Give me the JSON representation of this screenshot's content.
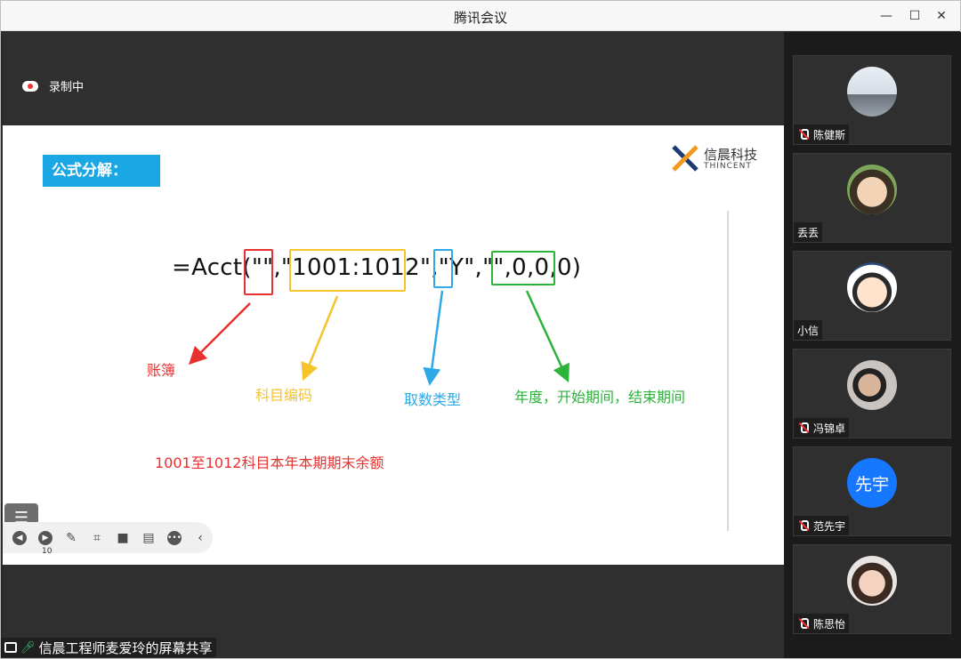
{
  "window": {
    "title": "腾讯会议"
  },
  "recording": {
    "label": "录制中"
  },
  "slide": {
    "tag": "公式分解：",
    "logo_cn": "信晨科技",
    "logo_en": "THINCENT",
    "formula": "=Acct(\"\",\"1001:1012\",\"Y\",\"\",0,0,0)",
    "annotations": {
      "ledger": "账簿",
      "account_code": "科目编码",
      "value_type": "取数类型",
      "period": "年度，开始期间，结束期间",
      "summary": "1001至1012科目本年本期期末余额"
    },
    "colors": {
      "red": "#e8312f",
      "yellow": "#f5c32a",
      "blue": "#2ea8e6",
      "green": "#2bb33a"
    },
    "page_number": "10"
  },
  "share": {
    "label": "信晨工程师麦爱玲的屏幕共享"
  },
  "participants": [
    {
      "name": "陈健斯",
      "muted": true,
      "avatar": "landscape"
    },
    {
      "name": "丢丢",
      "muted": false,
      "avatar": "child-photo"
    },
    {
      "name": "小信",
      "muted": false,
      "avatar": "cartoon-boy"
    },
    {
      "name": "冯锦卓",
      "muted": true,
      "avatar": "person-photo"
    },
    {
      "name": "范先宇",
      "muted": true,
      "avatar": "initials",
      "initials": "先宇"
    },
    {
      "name": "陈思怡",
      "muted": true,
      "avatar": "girl-photo"
    }
  ]
}
